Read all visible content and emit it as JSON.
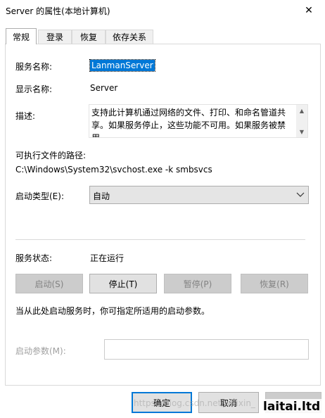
{
  "window": {
    "title": "Server 的属性(本地计算机)",
    "close_icon": "close-icon"
  },
  "tabs": [
    {
      "label": "常规",
      "active": true
    },
    {
      "label": "登录",
      "active": false
    },
    {
      "label": "恢复",
      "active": false
    },
    {
      "label": "依存关系",
      "active": false
    }
  ],
  "general": {
    "service_name_label": "服务名称:",
    "service_name_value": "LanmanServer",
    "display_name_label": "显示名称:",
    "display_name_value": "Server",
    "description_label": "描述:",
    "description_value": "支持此计算机通过网络的文件、打印、和命名管道共享。如果服务停止，这些功能不可用。如果服务被禁用，",
    "exe_path_label": "可执行文件的路径:",
    "exe_path_value": "C:\\Windows\\System32\\svchost.exe -k smbsvcs",
    "startup_type_label": "启动类型(E):",
    "startup_type_value": "自动",
    "status_label": "服务状态:",
    "status_value": "正在运行",
    "buttons": {
      "start": "启动(S)",
      "stop": "停止(T)",
      "pause": "暂停(P)",
      "resume": "恢复(R)"
    },
    "hint_text": "当从此处启动服务时，你可指定所适用的启动参数。",
    "params_label": "启动参数(M):",
    "params_value": ""
  },
  "footer": {
    "ok": "确定",
    "cancel": "取消",
    "apply": ""
  },
  "watermark": {
    "text": "https://blog.csdn.net/weixin_",
    "logo": "laitai.ltd"
  }
}
